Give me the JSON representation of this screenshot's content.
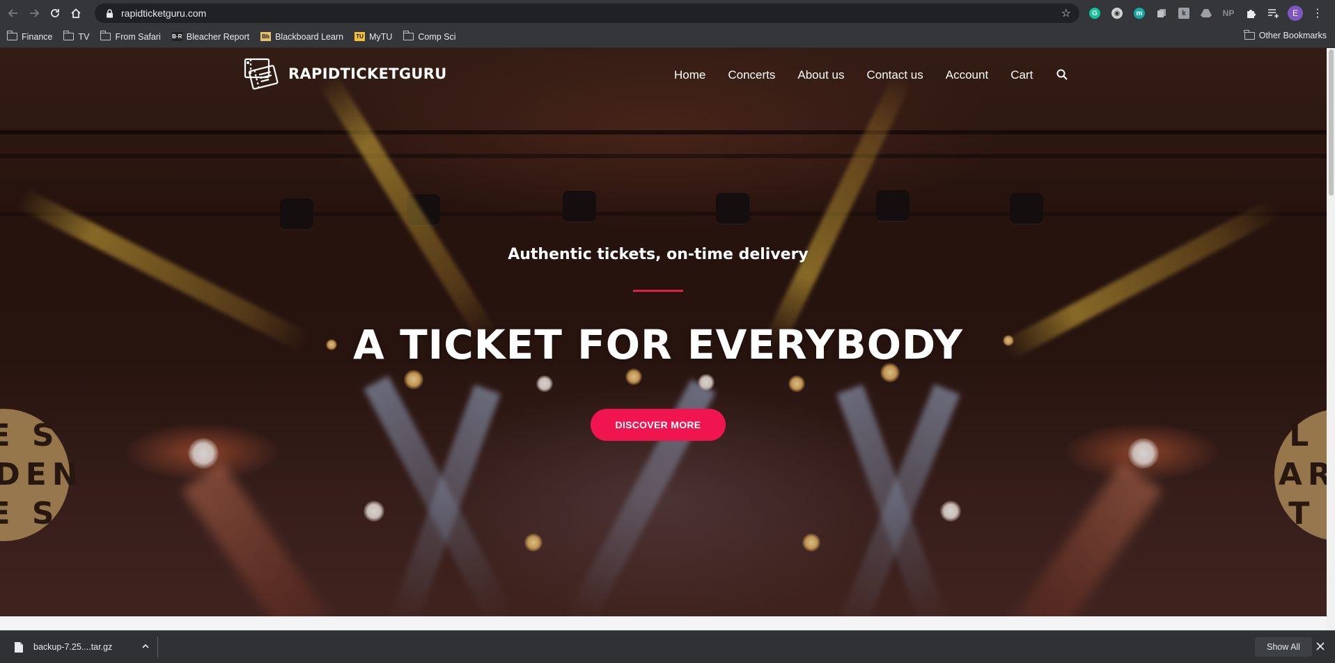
{
  "browser": {
    "url": "rapidticketguru.com",
    "bookmarks": [
      {
        "label": "Finance",
        "icon": "folder-icon"
      },
      {
        "label": "TV",
        "icon": "folder-icon"
      },
      {
        "label": "From Safari",
        "icon": "folder-icon"
      },
      {
        "label": "Bleacher Report",
        "icon": "bleacher-report-favicon"
      },
      {
        "label": "Blackboard Learn",
        "icon": "blackboard-favicon"
      },
      {
        "label": "MyTU",
        "icon": "mytu-favicon"
      },
      {
        "label": "Comp Sci",
        "icon": "folder-icon"
      }
    ],
    "other_bookmarks": "Other Bookmarks",
    "extensions": [
      "grammarly-icon",
      "extension-circle-icon",
      "extension-m-icon",
      "extension-copy-icon",
      "extension-k-icon",
      "drive-icon",
      "extension-np-icon",
      "puzzle-icon",
      "reading-list-icon"
    ],
    "np_label": "NP",
    "profile_initial": "E"
  },
  "site": {
    "brand": "RAPIDTICKETGURU",
    "nav": [
      "Home",
      "Concerts",
      "About us",
      "Contact us",
      "Account",
      "Cart"
    ],
    "tagline": "Authentic tickets, on-time delivery",
    "headline": "A TICKET FOR EVERYBODY",
    "cta": "DISCOVER MORE",
    "accent_color": "#f0144f",
    "sign_left": "E S\nRDEN\nE S",
    "sign_right": "L E\nARD\nT E"
  },
  "downloads": {
    "file": "backup-7.25....tar.gz",
    "show_all": "Show All"
  }
}
